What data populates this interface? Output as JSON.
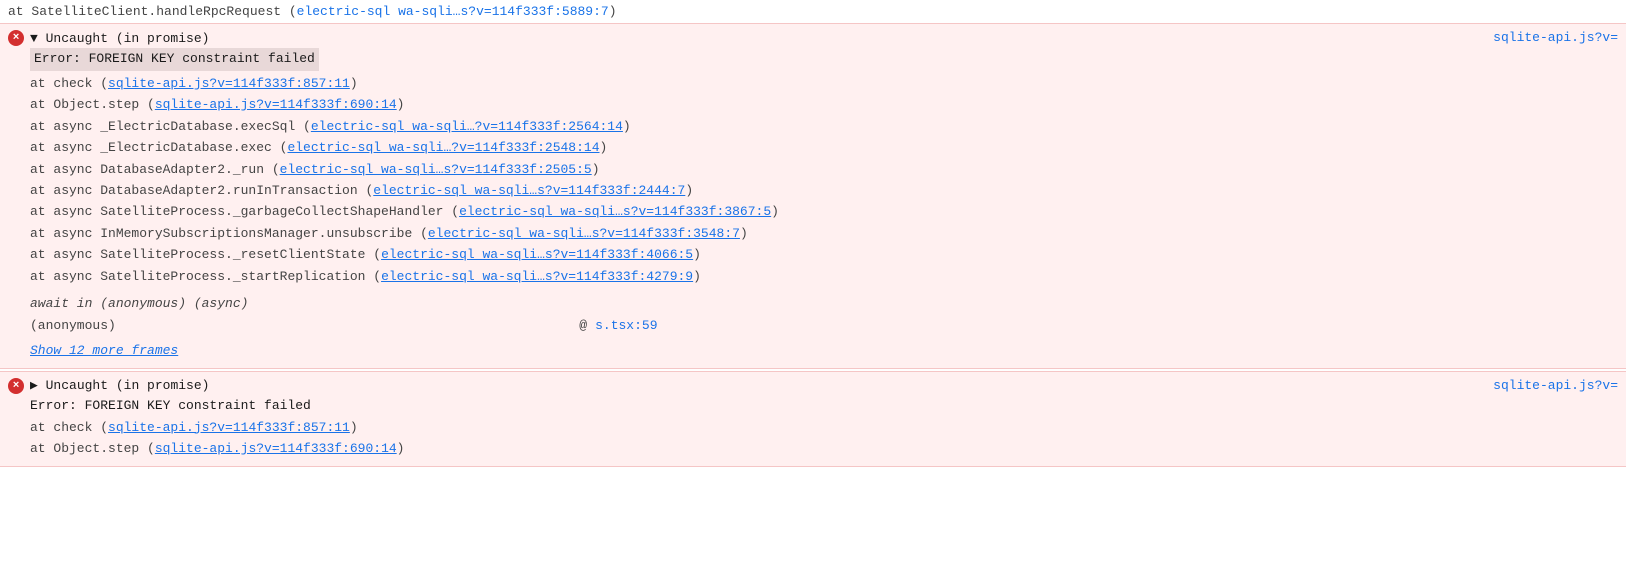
{
  "colors": {
    "error_bg": "#fff0f0",
    "error_icon": "#d32f2f",
    "link": "#1a73e8",
    "text": "#444444",
    "error_message_bg": "#e8d8d8"
  },
  "top_line": {
    "text": "    at SatelliteClient.handleRpcRequest (",
    "link_text": "electric-sql wa-sqli…s?v=114f333f:5889:7",
    "link_href": "#"
  },
  "error_block_1": {
    "icon": "×",
    "title": "▼ Uncaught (in promise)",
    "source_link": "sqlite-api.js?v=",
    "error_message": "Error: FOREIGN KEY constraint failed",
    "stack": [
      {
        "prefix": "    at check (",
        "link_text": "sqlite-api.js?v=114f333f:857:11",
        "link_href": "#",
        "suffix": ")"
      },
      {
        "prefix": "    at Object.step (",
        "link_text": "sqlite-api.js?v=114f333f:690:14",
        "link_href": "#",
        "suffix": ")"
      },
      {
        "prefix": "    at async _ElectricDatabase.execSql (",
        "link_text": "electric-sql wa-sqli…?v=114f333f:2564:14",
        "link_href": "#",
        "suffix": ")"
      },
      {
        "prefix": "    at async _ElectricDatabase.exec (",
        "link_text": "electric-sql wa-sqli…?v=114f333f:2548:14",
        "link_href": "#",
        "suffix": ")"
      },
      {
        "prefix": "    at async DatabaseAdapter2._run (",
        "link_text": "electric-sql wa-sqli…s?v=114f333f:2505:5",
        "link_href": "#",
        "suffix": ")"
      },
      {
        "prefix": "    at async DatabaseAdapter2.runInTransaction (",
        "link_text": "electric-sql wa-sqli…s?v=114f333f:2444:7",
        "link_href": "#",
        "suffix": ")"
      },
      {
        "prefix": "    at async SatelliteProcess._garbageCollectShapeHandler (",
        "link_text": "electric-sql wa-sqli…s?v=114f333f:3867:5",
        "link_href": "#",
        "suffix": ")"
      },
      {
        "prefix": "    at async InMemorySubscriptionsManager.unsubscribe (",
        "link_text": "electric-sql wa-sqli…s?v=114f333f:3548:7",
        "link_href": "#",
        "suffix": ")"
      },
      {
        "prefix": "    at async SatelliteProcess._resetClientState (",
        "link_text": "electric-sql wa-sqli…s?v=114f333f:4066:5",
        "link_href": "#",
        "suffix": ")"
      },
      {
        "prefix": "    at async SatelliteProcess._startReplication (",
        "link_text": "electric-sql wa-sqli…s?v=114f333f:4279:9",
        "link_href": "#",
        "suffix": ")"
      }
    ],
    "await_line": "  await in (anonymous) (async)",
    "anon_label": "(anonymous)",
    "anon_at": "@ s.tsx:59",
    "anon_at_link": "#",
    "anon_at_link_text": "s.tsx:59",
    "show_more": "Show 12 more frames"
  },
  "error_block_2": {
    "icon": "×",
    "title": "▶ Uncaught (in promise)",
    "source_link": "sqlite-api.js?v=",
    "error_message": "Error: FOREIGN KEY constraint failed",
    "stack_visible": [
      {
        "prefix": "    at check (",
        "link_text": "sqlite-api.js?v=114f333f:857:11",
        "link_href": "#",
        "suffix": ")"
      },
      {
        "prefix": "    at Object.step (",
        "link_text": "sqlite-api.js?v=114f333f:690:14",
        "link_href": "#",
        "suffix": ")"
      }
    ]
  }
}
